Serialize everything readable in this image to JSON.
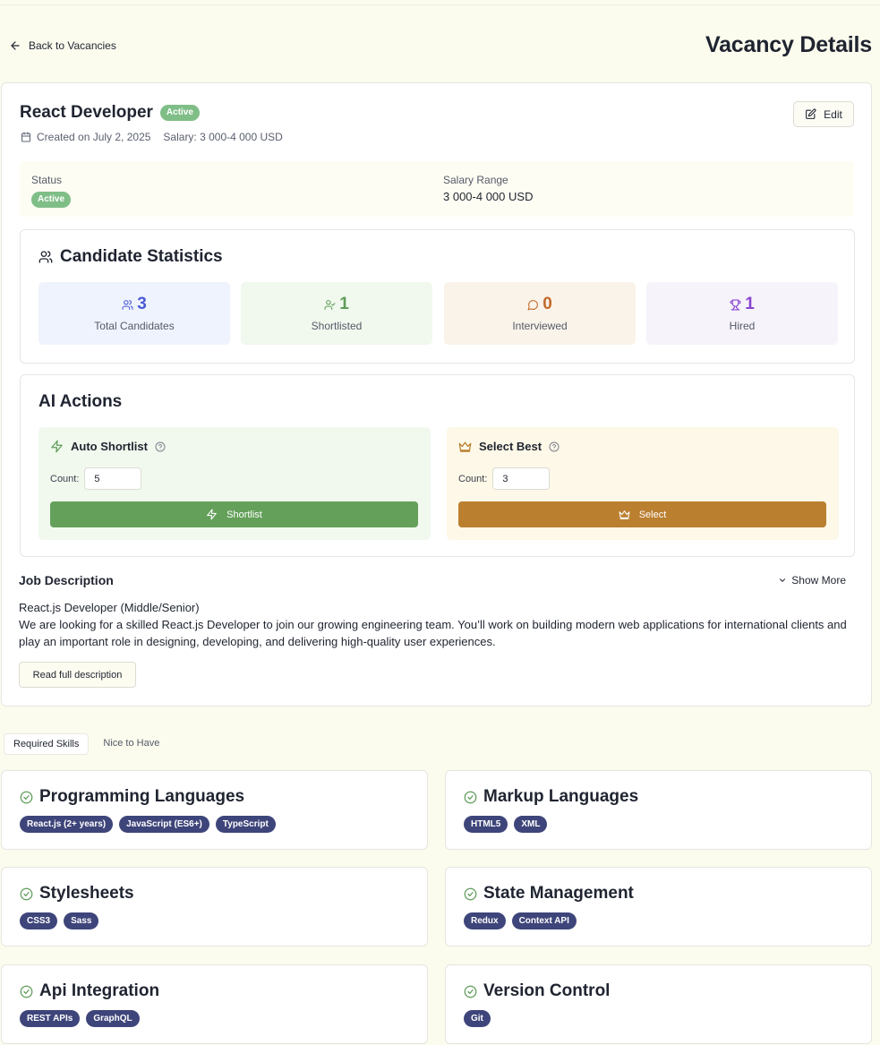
{
  "header": {
    "back_label": "Back to Vacancies",
    "page_title": "Vacancy Details"
  },
  "vacancy": {
    "title": "React Developer",
    "status_badge": "Active",
    "created_text": "Created on July 2, 2025",
    "salary_text": "Salary: 3 000-4 000 USD",
    "edit_label": "Edit"
  },
  "info": {
    "status_label": "Status",
    "status_value": "Active",
    "salary_label": "Salary Range",
    "salary_value": "3 000-4 000 USD"
  },
  "stats": {
    "title": "Candidate Statistics",
    "items": [
      {
        "value": "3",
        "label": "Total Candidates",
        "icon": "users-icon",
        "color": "#4a5bd4",
        "bg": "#eff3fd"
      },
      {
        "value": "1",
        "label": "Shortlisted",
        "icon": "user-check-icon",
        "color": "#5f9c5a",
        "bg": "#f1f9ee"
      },
      {
        "value": "0",
        "label": "Interviewed",
        "icon": "message-circle-icon",
        "color": "#c26a2a",
        "bg": "#faf3ea"
      },
      {
        "value": "1",
        "label": "Hired",
        "icon": "trophy-icon",
        "color": "#8a44d0",
        "bg": "#f6f3fb"
      }
    ]
  },
  "ai": {
    "title": "AI Actions",
    "auto_shortlist": {
      "title": "Auto Shortlist",
      "count_label": "Count:",
      "count_value": "5",
      "button_label": "Shortlist",
      "button_color": "#64a05a",
      "bg": "#f1f9ee",
      "icon": "zap-icon"
    },
    "select_best": {
      "title": "Select Best",
      "count_label": "Count:",
      "count_value": "3",
      "button_label": "Select",
      "button_color": "#bb7f30",
      "bg": "#fdf8e7",
      "icon": "crown-icon"
    }
  },
  "job_description": {
    "title": "Job Description",
    "show_more": "Show More",
    "line1": "React.js Developer (Middle/Senior)",
    "line2": "We are looking for a skilled React.js Developer to join our growing engineering team. You’ll work on building modern web applications for international clients and play an important role in designing, developing, and delivering high-quality user experiences.",
    "read_full": "Read full description"
  },
  "tabs": [
    {
      "label": "Required Skills",
      "active": true
    },
    {
      "label": "Nice to Have",
      "active": false
    }
  ],
  "skills": [
    {
      "title": "Programming Languages",
      "chips": [
        "React.js (2+ years)",
        "JavaScript (ES6+)",
        "TypeScript"
      ]
    },
    {
      "title": "Markup Languages",
      "chips": [
        "HTML5",
        "XML"
      ]
    },
    {
      "title": "Stylesheets",
      "chips": [
        "CSS3",
        "Sass"
      ]
    },
    {
      "title": "State Management",
      "chips": [
        "Redux",
        "Context API"
      ]
    },
    {
      "title": "Api Integration",
      "chips": [
        "REST APIs",
        "GraphQL"
      ]
    },
    {
      "title": "Version Control",
      "chips": [
        "Git"
      ]
    }
  ],
  "colors": {
    "page_bg": "#fbfbee",
    "active_badge": "#7fbe87",
    "chip_bg": "#3e457a",
    "check_green": "#5f9c5a"
  }
}
